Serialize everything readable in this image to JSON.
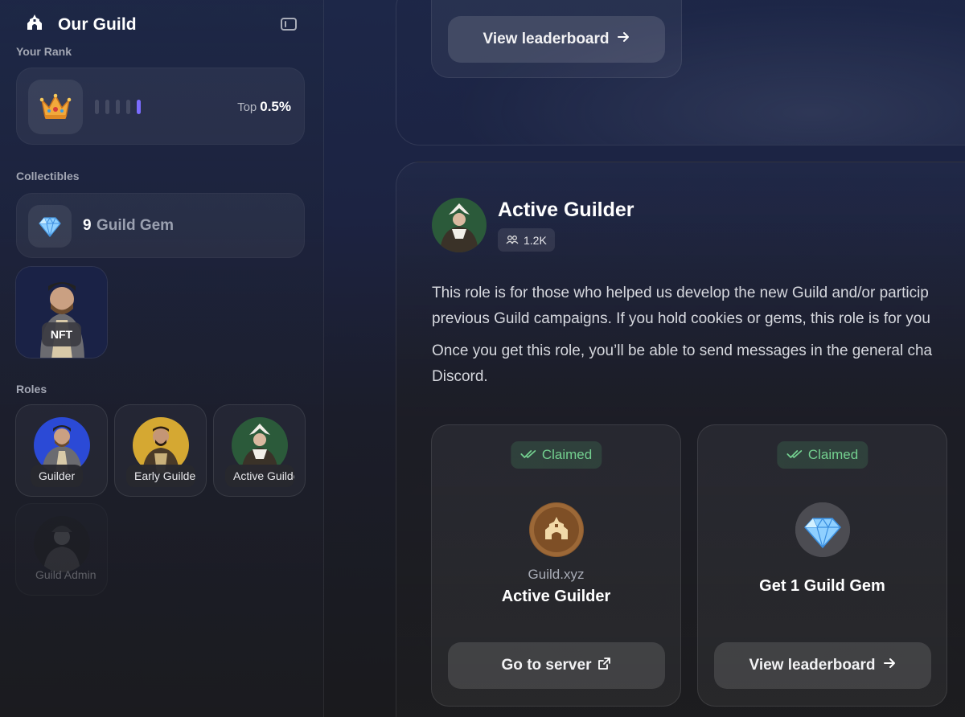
{
  "sidebar": {
    "title": "Our Guild",
    "rank": {
      "label": "Your Rank",
      "prefix": "Top",
      "value": "0.5%",
      "bar_count": 5,
      "active_bar": 5
    },
    "collectibles": {
      "label": "Collectibles",
      "gem_count": "9",
      "gem_name": "Guild Gem",
      "nft_badge": "NFT"
    },
    "roles": {
      "label": "Roles",
      "items": [
        {
          "label": "Guilder",
          "locked": false
        },
        {
          "label": "Early Guilder",
          "locked": false
        },
        {
          "label": "Active Guilder",
          "locked": false
        },
        {
          "label": "Guild Admin",
          "locked": true
        }
      ]
    }
  },
  "top_panel": {
    "button_label": "View leaderboard"
  },
  "role_detail": {
    "title": "Active Guilder",
    "member_count": "1.2K",
    "description_lines": [
      "This role is for those who helped us develop the new Guild and/or particip",
      "previous Guild campaigns. If you hold cookies or gems, this role is for you",
      "Once you get this role, you’ll be able to send messages in the general cha",
      "Discord."
    ],
    "rewards": [
      {
        "status": "Claimed",
        "subtitle": "Guild.xyz",
        "title": "Active Guilder",
        "button_label": "Go to server",
        "icon": "guild-logo-icon",
        "button_icon": "external-link-icon"
      },
      {
        "status": "Claimed",
        "subtitle": "",
        "title": "Get 1 Guild Gem",
        "button_label": "View leaderboard",
        "icon": "gem-icon",
        "button_icon": "arrow-right-icon"
      }
    ]
  },
  "colors": {
    "accent_bar": "#7b6cff",
    "claimed_text": "#73cf8f"
  }
}
